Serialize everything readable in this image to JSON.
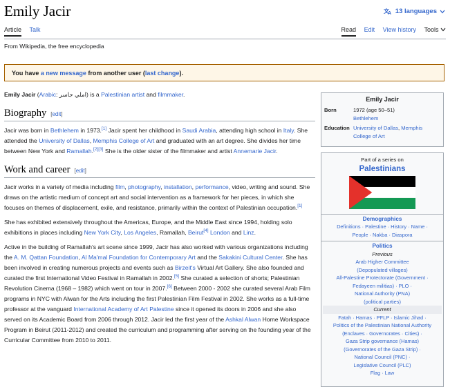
{
  "page": {
    "title": "Emily Jacir",
    "languages": "13 languages",
    "tabs_left": [
      "Article",
      "Talk"
    ],
    "tabs_right": [
      "Read",
      "Edit",
      "View history",
      "Tools"
    ],
    "from": "From Wikipedia, the free encyclopedia"
  },
  "notice": {
    "prefix": "You have ",
    "link1": "a new message",
    "mid": " from another user (",
    "link2": "last change",
    "suffix": ")."
  },
  "intro": {
    "name": "Emily Jacir",
    "p1": " (",
    "arabic_link": "Arabic",
    "arabic": ": املي جاسر",
    "p2": ") is a ",
    "link_pal": "Palestinian artist",
    "p3": " and ",
    "link_film": "filmmaker",
    "p4": "."
  },
  "sections": {
    "biography": "Biography",
    "work": "Work and career",
    "edit": "edit"
  },
  "bio": {
    "t1": "Jacir was born in ",
    "l_beth": "Bethlehem",
    "t2": " in 1973.",
    "r1": "[1]",
    "t3": " Jacir spent her childhood in ",
    "l_saudi": "Saudi Arabia",
    "t4": ", attending high school in ",
    "l_italy": "Italy",
    "t5": ". She attended the ",
    "l_dallas": "University of Dallas",
    "t6": ", ",
    "l_memphis": "Memphis College of Art",
    "t7": " and graduated with an art degree. She divides her time between New York and ",
    "l_ramallah": "Ramallah",
    "t8": ".",
    "r2": "[2][3]",
    "t9": " She is the older sister of the filmmaker and artist ",
    "l_annemarie": "Annemarie Jacir",
    "t10": "."
  },
  "work": {
    "p1a": "Jacir works in a variety of media including ",
    "l_film": "film",
    "c1": ", ",
    "l_photo": "photography",
    "c2": ", ",
    "l_install": "installation",
    "c3": ", ",
    "l_perf": "performance",
    "p1b": ", video, writing and sound. She draws on the artistic medium of concept art and social intervention as a framework for her pieces, in which she focuses on themes of displacement, exile, and resistance, primarily within the context of Palestinian occupation.",
    "r1": "[1]",
    "p2a": "She has exhibited extensively throughout the Americas, Europe, and the Middle East since 1994, holding solo exhibitions in places including ",
    "l_nyc": "New York City",
    "c4": ", ",
    "l_la": "Los Angeles",
    "p2b": ", Ramallah, ",
    "l_beirut": "Beirut",
    "r4": "[4]",
    "c5": " ",
    "l_london": "London",
    "p2c": " and ",
    "l_linz": "Linz",
    "p2d": ".",
    "p3a": "Active in the building of Ramallah's art scene since 1999, Jacir has also worked with various organizations including the ",
    "l_qattan": "A. M. Qattan Foundation",
    "c6": ", ",
    "l_almamal": "Al Ma'mal Foundation for Contemporary Art",
    "p3b": " and the ",
    "l_sakakini": "Sakakini Cultural Center",
    "p3c": ". She has been involved in creating numerous projects and events such as ",
    "l_birzeit": "Birzeit's",
    "p3d": " Virtual Art Gallery. She also founded and curated the first International Video Festival in Ramallah in 2002.",
    "r5": "[5]",
    "p3e": " She curated a selection of shorts; Palestinian Revolution Cinema (1968 – 1982) which went on tour in 2007.",
    "r6": "[6]",
    "p3f": " Between 2000 - 2002 she curated several Arab Film programs in NYC with Alwan for the Arts including the first Palestinian Film Festival in 2002. She works as a full-time professor at the vanguard ",
    "l_iap": "International Academy of Art Palestine",
    "p3g": " since it opened its doors in 2006 and she also served on its Academic Board from 2006 through 2012. Jacir led the first year of the ",
    "l_ashkal": "Ashkal Alwan",
    "p3h": " Home Workspace Program in Beirut (2011-2012) and created the curriculum and programming after serving on the founding year of the Curricular Committee from 2010 to 2011."
  },
  "infobox": {
    "title": "Emily Jacir",
    "born_label": "Born",
    "born_value": "1972 (age 50–51)",
    "born_place": "Bethlehem",
    "edu_label": "Education",
    "edu_value1": "University of Dallas",
    "edu_sep": ", ",
    "edu_value2": "Memphis College of Art"
  },
  "navbox": {
    "part": "Part of a series on",
    "title": "Palestinians",
    "demo_head": "Demographics",
    "demo_1": "Definitions · Palestine · History · Name ·",
    "demo_2": "People · Nakba · Diaspora",
    "pol_head": "Politics",
    "previous": "Previous",
    "prev_1": "Arab Higher Committee",
    "prev_2": "(Depopulated villages)",
    "prev_3": "All-Palestine Protectorate (Government ·",
    "prev_4": "Fedayeen militias) · PLO ·",
    "prev_5": "National Authority (PNA)",
    "prev_6": "(political parties)",
    "current": "Current",
    "cur_1": "Fatah · Hamas · PFLP · Islamic Jihad ·",
    "cur_2": "Politics of the Palestinian National Authority",
    "cur_3": "(Enclaves · Governorates · Cities) ·",
    "cur_4": "Gaza Strip governance (Hamas)",
    "cur_5": "(Governorates of the Gaza Strip) ·",
    "cur_6": "National Council (PNC) ·",
    "cur_7": "Legislative Council (PLC)",
    "cur_8": "Flag · Law"
  },
  "colors": {
    "link": "#3366cc",
    "notice_bg": "#fef6e7",
    "notice_border": "#a66200",
    "flag_black": "#000000",
    "flag_white": "#ffffff",
    "flag_green": "#149954",
    "flag_red": "#e4312b"
  }
}
